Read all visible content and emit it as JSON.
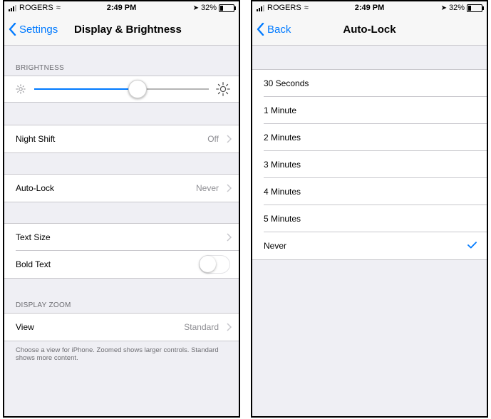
{
  "status_bar": {
    "carrier": "ROGERS",
    "time": "2:49 PM",
    "battery_text": "32%",
    "battery_level": 0.32
  },
  "left_screen": {
    "back_label": "Settings",
    "title": "Display & Brightness",
    "brightness_header": "BRIGHTNESS",
    "brightness_level": 0.59,
    "night_shift": {
      "label": "Night Shift",
      "value": "Off"
    },
    "auto_lock": {
      "label": "Auto-Lock",
      "value": "Never"
    },
    "text_size": {
      "label": "Text Size"
    },
    "bold_text": {
      "label": "Bold Text",
      "enabled": false
    },
    "display_zoom_header": "DISPLAY ZOOM",
    "view": {
      "label": "View",
      "value": "Standard"
    },
    "footnote": "Choose a view for iPhone. Zoomed shows larger controls. Standard shows more content."
  },
  "right_screen": {
    "back_label": "Back",
    "title": "Auto-Lock",
    "options": [
      "30 Seconds",
      "1 Minute",
      "2 Minutes",
      "3 Minutes",
      "4 Minutes",
      "5 Minutes",
      "Never"
    ],
    "selected": "Never"
  },
  "colors": {
    "accent": "#007aff",
    "background": "#efeff4",
    "secondary_text": "#8e8e93",
    "separator": "#c8c7cc"
  },
  "icons": {
    "back": "chevron-left-icon",
    "disclosure": "chevron-right-icon",
    "brightness_low": "sun-small-icon",
    "brightness_high": "sun-large-icon",
    "selected": "checkmark-icon",
    "wifi": "wifi-icon",
    "location": "location-arrow-icon",
    "battery": "battery-icon",
    "signal": "signal-bars-icon"
  }
}
